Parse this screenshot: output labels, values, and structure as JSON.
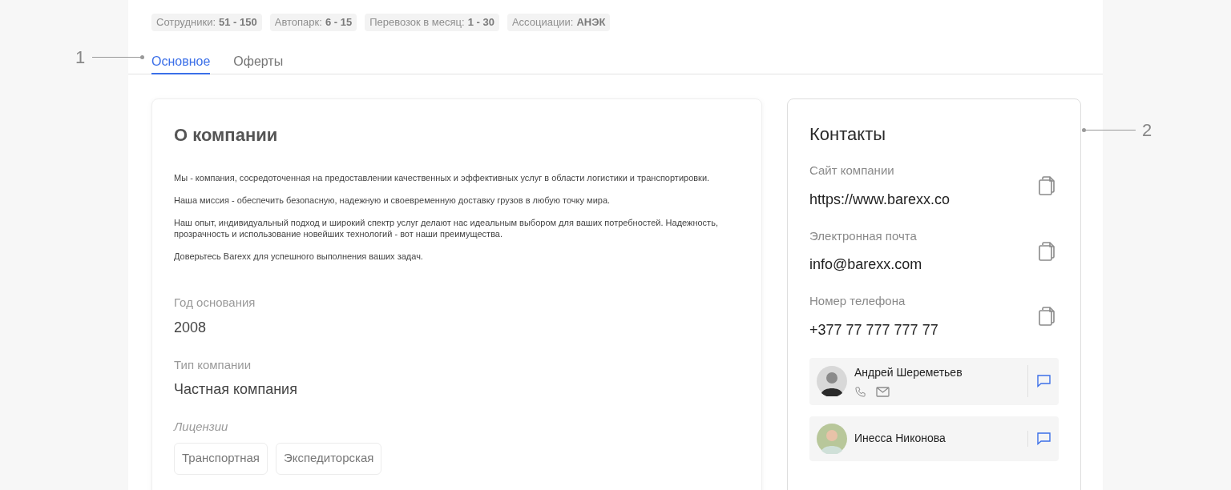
{
  "stats": {
    "items": [
      {
        "label": "Сотрудники:",
        "value": "51 - 150"
      },
      {
        "label": "Автопарк:",
        "value": "6 - 15"
      },
      {
        "label": "Перевозок в месяц:",
        "value": "1 - 30"
      },
      {
        "label": "Ассоциации:",
        "value": "АНЭК"
      }
    ]
  },
  "tabs": [
    {
      "label": "Основное",
      "selected": true
    },
    {
      "label": "Оферты",
      "selected": false
    }
  ],
  "about": {
    "title": "О компании",
    "paragraphs": [
      "Мы - компания, сосредоточенная на предоставлении качественных и эффективных услуг в области логистики и транспортировки.",
      "Наша миссия - обеспечить безопасную, надежную и своевременную доставку грузов в любую точку мира.",
      "Наш опыт, индивидуальный подход и широкий спектр услуг делают нас идеальным выбором для ваших потребностей. Надежность, прозрачность и использование новейших технологий - вот наши преимущества.",
      "Доверьтесь Barexx для успешного выполнения ваших задач."
    ],
    "fields": [
      {
        "label": "Год основания",
        "value": "2008"
      },
      {
        "label": "Тип компании",
        "value": "Частная компания"
      }
    ],
    "licenses": {
      "label": "Лицензии",
      "items": [
        "Транспортная",
        "Экспедиторская"
      ]
    }
  },
  "contacts": {
    "title": "Контакты",
    "fields": [
      {
        "label": "Сайт компании",
        "value": "https://www.barexx.co"
      },
      {
        "label": "Электронная почта",
        "value": "info@barexx.com"
      },
      {
        "label": "Номер телефона",
        "value": "+377 77 777 777 77"
      }
    ],
    "people": [
      {
        "name": "Андрей Шереметьев",
        "phone": true,
        "email": true
      },
      {
        "name": "Инесса Никонова",
        "phone": false,
        "email": false
      }
    ]
  },
  "callouts": [
    "1",
    "2"
  ]
}
